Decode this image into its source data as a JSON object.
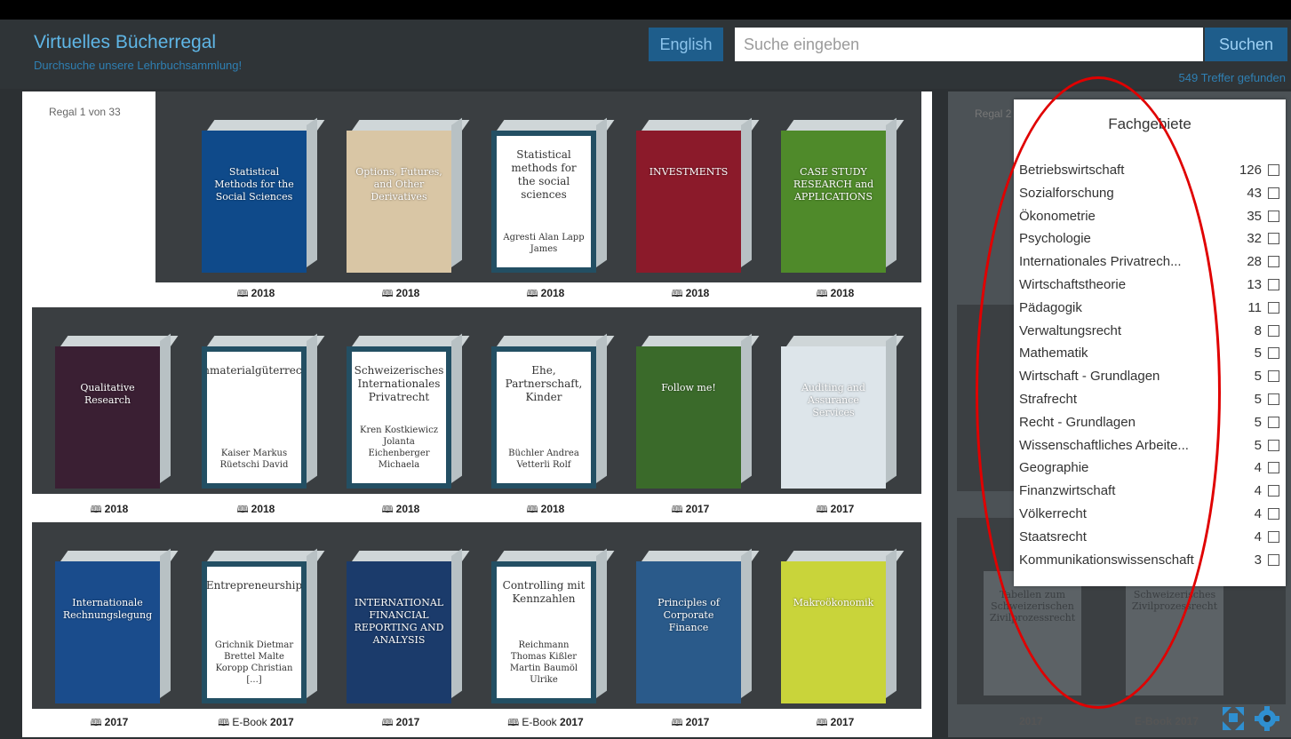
{
  "header": {
    "title": "Virtuelles Bücherregal",
    "subtitle": "Durchsuche unsere Lehrbuchsammlung!",
    "lang_button": "English",
    "search_placeholder": "Suche eingeben",
    "search_button": "Suchen",
    "hits": "549 Treffer gefunden"
  },
  "shelf": {
    "label": "Regal 1 von 33"
  },
  "books": [
    {
      "title": "Statistical Methods for the Social Sciences",
      "year": "2018",
      "color": "#0f4a8a"
    },
    {
      "title": "Options, Futures, and Other Derivatives",
      "year": "2018",
      "color": "#d9c6a5"
    },
    {
      "title": "Statistical methods for the social sciences",
      "authors": "Agresti Alan Lapp James",
      "year": "2018"
    },
    {
      "title": "INVESTMENTS",
      "year": "2018",
      "color": "#8b1a2a"
    },
    {
      "title": "CASE STUDY RESEARCH and APPLICATIONS",
      "year": "2018",
      "color": "#4f8a2a"
    },
    {
      "title": "Qualitative Research",
      "year": "2018",
      "color": "#3a1f33"
    },
    {
      "title": "Immaterialgüterrecht",
      "authors": "Kaiser Markus Rüetschi David",
      "year": "2018"
    },
    {
      "title": "Schweizerisches Internationales Privatrecht",
      "authors": "Kren Kostkiewicz Jolanta Eichenberger Michaela",
      "year": "2018"
    },
    {
      "title": "Ehe, Partnerschaft, Kinder",
      "authors": "Büchler Andrea Vetterli Rolf",
      "year": "2018"
    },
    {
      "title": "Follow me!",
      "year": "2017",
      "color": "#3a6a2a"
    },
    {
      "title": "Auditing and Assurance Services",
      "year": "2017",
      "color": "#dde5ea"
    },
    {
      "title": "Internationale Rechnungslegung",
      "year": "2017",
      "color": "#1a4c8c"
    },
    {
      "title": "Entrepreneurship",
      "authors": "Grichnik Dietmar Brettel Malte Koropp Christian [...]",
      "year": "2017",
      "ebook": "E-Book"
    },
    {
      "title": "INTERNATIONAL FINANCIAL REPORTING AND ANALYSIS",
      "year": "2017",
      "color": "#1b3b6b"
    },
    {
      "title": "Controlling mit Kennzahlen",
      "authors": "Reichmann Thomas Kißler Martin Baumöl Ulrike",
      "year": "2017",
      "ebook": "E-Book"
    },
    {
      "title": "Principles of Corporate Finance",
      "year": "2017",
      "color": "#2a5a8a"
    },
    {
      "title": "Makroökonomik",
      "year": "2017",
      "color": "#c9d43a"
    }
  ],
  "filter": {
    "title": "Fachgebiete",
    "items": [
      {
        "name": "Betriebswirtschaft",
        "count": "126"
      },
      {
        "name": "Sozialforschung",
        "count": "43"
      },
      {
        "name": "Ökonometrie",
        "count": "35"
      },
      {
        "name": "Psychologie",
        "count": "32"
      },
      {
        "name": "Internationales Privatrech...",
        "count": "28"
      },
      {
        "name": "Wirtschaftstheorie",
        "count": "13"
      },
      {
        "name": "Pädagogik",
        "count": "11"
      },
      {
        "name": "Verwaltungsrecht",
        "count": "8"
      },
      {
        "name": "Mathematik",
        "count": "5"
      },
      {
        "name": "Wirtschaft - Grundlagen",
        "count": "5"
      },
      {
        "name": "Strafrecht",
        "count": "5"
      },
      {
        "name": "Recht - Grundlagen",
        "count": "5"
      },
      {
        "name": "Wissenschaftliches Arbeite...",
        "count": "5"
      },
      {
        "name": "Geographie",
        "count": "4"
      },
      {
        "name": "Finanzwirtschaft",
        "count": "4"
      },
      {
        "name": "Völkerrecht",
        "count": "4"
      },
      {
        "name": "Staatsrecht",
        "count": "4"
      },
      {
        "name": "Kommunikationswissenschaft",
        "count": "3"
      }
    ]
  },
  "right_shelf": {
    "label": "Regal 2",
    "book_titles": [
      "Tabellen zum Schweizerischen Zivilprozessrecht",
      "Schweizerisches Zivilprozessrecht"
    ],
    "years": [
      "2017",
      "E-Book 2017"
    ]
  },
  "icons": [
    "expand-icon",
    "gear-icon"
  ]
}
